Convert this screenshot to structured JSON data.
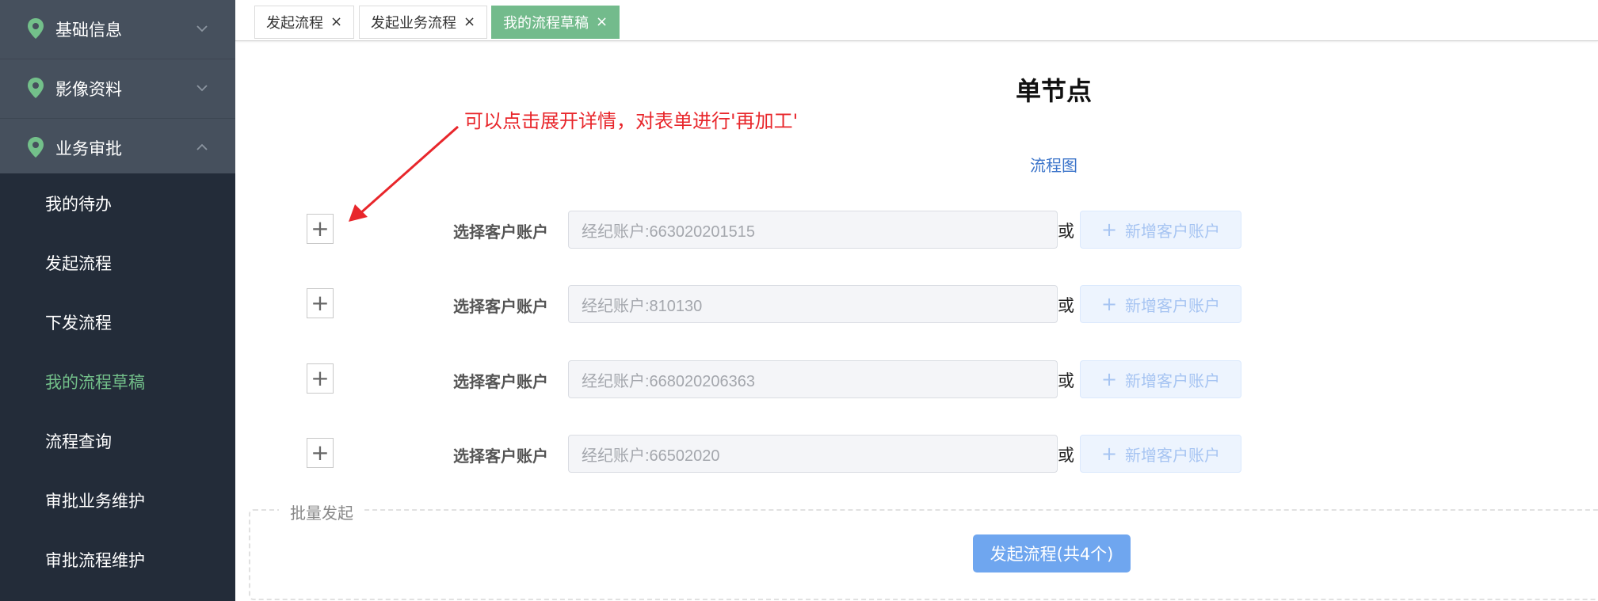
{
  "sidebar": {
    "groups": [
      {
        "label": "基础信息"
      },
      {
        "label": "影像资料"
      },
      {
        "label": "业务审批"
      }
    ],
    "items": [
      {
        "label": "我的待办"
      },
      {
        "label": "发起流程"
      },
      {
        "label": "下发流程"
      },
      {
        "label": "我的流程草稿"
      },
      {
        "label": "流程查询"
      },
      {
        "label": "审批业务维护"
      },
      {
        "label": "审批流程维护"
      }
    ],
    "active_item": "我的流程草稿"
  },
  "tabs": [
    {
      "label": "发起流程",
      "close": "×"
    },
    {
      "label": "发起业务流程",
      "close": "×"
    },
    {
      "label": "我的流程草稿",
      "close": "×"
    }
  ],
  "main": {
    "title": "单节点",
    "annotation": "可以点击展开详情，对表单进行'再加工'",
    "flow_link": "流程图",
    "rows": [
      {
        "label": "选择客户账户",
        "placeholder": "经纪账户:663020201515",
        "or": "或",
        "add_label": "新增客户账户"
      },
      {
        "label": "选择客户账户",
        "placeholder": "经纪账户:810130",
        "or": "或",
        "add_label": "新增客户账户"
      },
      {
        "label": "选择客户账户",
        "placeholder": "经纪账户:668020206363",
        "or": "或",
        "add_label": "新增客户账户"
      },
      {
        "label": "选择客户账户",
        "placeholder": "经纪账户:66502020",
        "or": "或",
        "add_label": "新增客户账户"
      }
    ],
    "batch_legend": "批量发起",
    "submit_label": "发起流程(共4个)"
  },
  "colors": {
    "accent_green": "#73bb8c",
    "annotation_red": "#e8262b",
    "link_blue": "#3a73c9",
    "primary_button": "#6fa6ef"
  }
}
